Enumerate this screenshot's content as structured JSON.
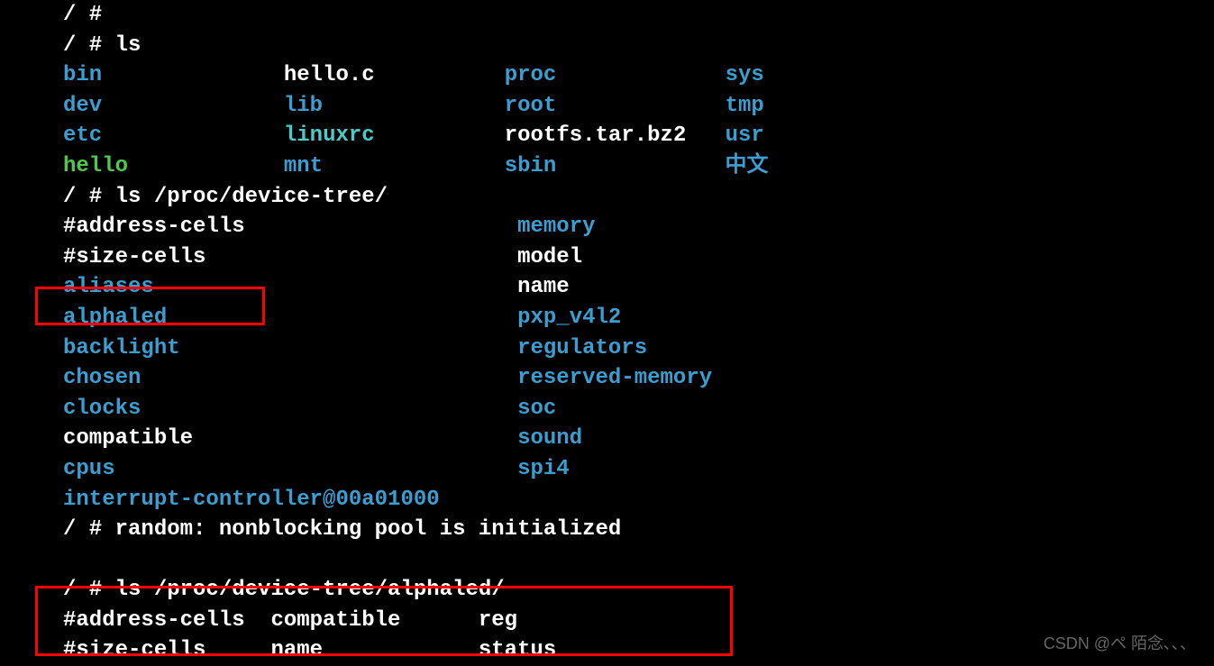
{
  "lines": [
    {
      "segments": [
        {
          "text": "/ #",
          "cls": "white"
        }
      ]
    },
    {
      "segments": [
        {
          "text": "/ # ls",
          "cls": "white"
        }
      ]
    },
    {
      "segments": [
        {
          "text": "bin",
          "cls": "blue"
        },
        {
          "text": "              ",
          "cls": "white"
        },
        {
          "text": "hello.c",
          "cls": "white"
        },
        {
          "text": "          ",
          "cls": "white"
        },
        {
          "text": "proc",
          "cls": "blue"
        },
        {
          "text": "             ",
          "cls": "white"
        },
        {
          "text": "sys",
          "cls": "blue"
        }
      ]
    },
    {
      "segments": [
        {
          "text": "dev",
          "cls": "blue"
        },
        {
          "text": "              ",
          "cls": "white"
        },
        {
          "text": "lib",
          "cls": "blue"
        },
        {
          "text": "              ",
          "cls": "white"
        },
        {
          "text": "root",
          "cls": "blue"
        },
        {
          "text": "             ",
          "cls": "white"
        },
        {
          "text": "tmp",
          "cls": "blue"
        }
      ]
    },
    {
      "segments": [
        {
          "text": "etc",
          "cls": "blue"
        },
        {
          "text": "              ",
          "cls": "white"
        },
        {
          "text": "linuxrc",
          "cls": "cyan"
        },
        {
          "text": "          ",
          "cls": "white"
        },
        {
          "text": "rootfs.tar.bz2",
          "cls": "white"
        },
        {
          "text": "   ",
          "cls": "white"
        },
        {
          "text": "usr",
          "cls": "blue"
        }
      ]
    },
    {
      "segments": [
        {
          "text": "hello",
          "cls": "green"
        },
        {
          "text": "            ",
          "cls": "white"
        },
        {
          "text": "mnt",
          "cls": "blue"
        },
        {
          "text": "              ",
          "cls": "white"
        },
        {
          "text": "sbin",
          "cls": "blue"
        },
        {
          "text": "             ",
          "cls": "white"
        },
        {
          "text": "中文",
          "cls": "blue"
        }
      ]
    },
    {
      "segments": [
        {
          "text": "/ # ls /proc/device-tree/",
          "cls": "white"
        }
      ]
    },
    {
      "segments": [
        {
          "text": "#address-cells",
          "cls": "white"
        },
        {
          "text": "                     ",
          "cls": "white"
        },
        {
          "text": "memory",
          "cls": "blue"
        }
      ]
    },
    {
      "segments": [
        {
          "text": "#size-cells",
          "cls": "white"
        },
        {
          "text": "                        ",
          "cls": "white"
        },
        {
          "text": "model",
          "cls": "white"
        }
      ]
    },
    {
      "segments": [
        {
          "text": "aliases",
          "cls": "blue"
        },
        {
          "text": "                            ",
          "cls": "white"
        },
        {
          "text": "name",
          "cls": "white"
        }
      ]
    },
    {
      "segments": [
        {
          "text": "alphaled",
          "cls": "blue"
        },
        {
          "text": "                           ",
          "cls": "white"
        },
        {
          "text": "pxp_v4l2",
          "cls": "blue"
        }
      ]
    },
    {
      "segments": [
        {
          "text": "backlight",
          "cls": "blue"
        },
        {
          "text": "                          ",
          "cls": "white"
        },
        {
          "text": "regulators",
          "cls": "blue"
        }
      ]
    },
    {
      "segments": [
        {
          "text": "chosen",
          "cls": "blue"
        },
        {
          "text": "                             ",
          "cls": "white"
        },
        {
          "text": "reserved-memory",
          "cls": "blue"
        }
      ]
    },
    {
      "segments": [
        {
          "text": "clocks",
          "cls": "blue"
        },
        {
          "text": "                             ",
          "cls": "white"
        },
        {
          "text": "soc",
          "cls": "blue"
        }
      ]
    },
    {
      "segments": [
        {
          "text": "compatible",
          "cls": "white"
        },
        {
          "text": "                         ",
          "cls": "white"
        },
        {
          "text": "sound",
          "cls": "blue"
        }
      ]
    },
    {
      "segments": [
        {
          "text": "cpus",
          "cls": "blue"
        },
        {
          "text": "                               ",
          "cls": "white"
        },
        {
          "text": "spi4",
          "cls": "blue"
        }
      ]
    },
    {
      "segments": [
        {
          "text": "interrupt-controller@00a01000",
          "cls": "blue"
        }
      ]
    },
    {
      "segments": [
        {
          "text": "/ # random: nonblocking pool is initialized",
          "cls": "white"
        }
      ]
    },
    {
      "segments": [
        {
          "text": "",
          "cls": "white"
        }
      ]
    },
    {
      "segments": [
        {
          "text": "/ # ls /proc/device-tree/alphaled/",
          "cls": "white"
        }
      ]
    },
    {
      "segments": [
        {
          "text": "#address-cells  compatible      reg",
          "cls": "white"
        }
      ]
    },
    {
      "segments": [
        {
          "text": "#size-cells     name            status",
          "cls": "white"
        }
      ]
    }
  ],
  "watermark": "CSDN @ペ 陌念､､、"
}
